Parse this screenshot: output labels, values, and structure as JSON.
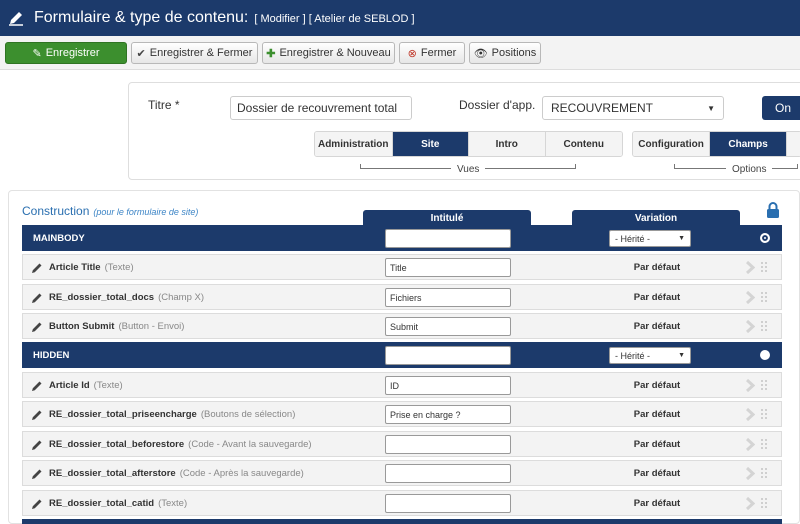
{
  "header": {
    "title": "Formulaire & type de contenu:",
    "subtitle": "[ Modifier ] [ Atelier de SEBLOD ]",
    "icon": "pen-icon"
  },
  "toolbar": {
    "save": "Enregistrer",
    "save_close": "Enregistrer & Fermer",
    "save_new": "Enregistrer & Nouveau",
    "close": "Fermer",
    "positions": "Positions"
  },
  "config": {
    "title_label": "Titre *",
    "title_value": "Dossier de recouvrement total",
    "folder_label": "Dossier d'app.",
    "folder_value": "RECOUVREMENT",
    "on_label": "On",
    "views_tabs": [
      "Administration",
      "Site",
      "Intro",
      "Contenu"
    ],
    "views_active": "Site",
    "views_label": "Vues",
    "options_tabs": [
      "Configuration",
      "Champs"
    ],
    "options_active": "Champs",
    "options_label": "Options"
  },
  "construction": {
    "title": "Construction",
    "note": "(pour le formulaire de site)",
    "col_label": "Intitulé",
    "col_variation": "Variation",
    "rows": [
      {
        "kind": "section",
        "name": "MAINBODY",
        "input": "",
        "variation": "- Hérité -"
      },
      {
        "kind": "field",
        "name": "Article Title",
        "type": "(Texte)",
        "input": "Title",
        "variation": "Par défaut"
      },
      {
        "kind": "field",
        "name": "RE_dossier_total_docs",
        "type": "(Champ X)",
        "input": "Fichiers",
        "variation": "Par défaut"
      },
      {
        "kind": "field",
        "name": "Button Submit",
        "type": "(Button - Envoi)",
        "input": "Submit",
        "variation": "Par défaut"
      },
      {
        "kind": "section",
        "name": "HIDDEN",
        "input": "",
        "variation": "- Hérité -"
      },
      {
        "kind": "field",
        "name": "Article Id",
        "type": "(Texte)",
        "input": "ID",
        "variation": "Par défaut"
      },
      {
        "kind": "field",
        "name": "RE_dossier_total_priseencharge",
        "type": "(Boutons de sélection)",
        "input": "Prise en charge ?",
        "variation": "Par défaut"
      },
      {
        "kind": "field",
        "name": "RE_dossier_total_beforestore",
        "type": "(Code - Avant la sauvegarde)",
        "input": "",
        "variation": "Par défaut"
      },
      {
        "kind": "field",
        "name": "RE_dossier_total_afterstore",
        "type": "(Code - Après la sauvegarde)",
        "input": "",
        "variation": "Par défaut"
      },
      {
        "kind": "field",
        "name": "RE_dossier_total_catid",
        "type": "(Texte)",
        "input": "",
        "variation": "Par défaut"
      }
    ]
  },
  "colors": {
    "navy": "#1c3a6b",
    "green": "#3c8f2e",
    "link_blue": "#2a6fb0"
  }
}
